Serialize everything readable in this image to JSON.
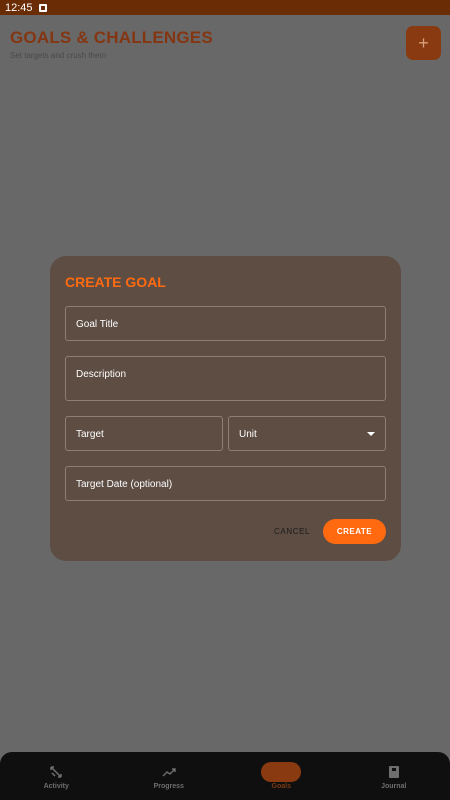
{
  "status_bar": {
    "time": "12:45",
    "notification_icon": "notification-icon"
  },
  "header": {
    "title": "GOALS & CHALLENGES",
    "subtitle": "Set targets and crush them",
    "add_label": "+"
  },
  "dialog": {
    "title": "CREATE GOAL",
    "fields": {
      "goal_title": "Goal Title",
      "description": "Description",
      "target": "Target",
      "unit": "Unit",
      "target_date": "Target Date (optional)"
    },
    "cancel_label": "CANCEL",
    "create_label": "CREATE"
  },
  "bottom_nav": {
    "items": [
      {
        "label": "Activity",
        "icon": "activity-icon"
      },
      {
        "label": "Progress",
        "icon": "trending-up-icon"
      },
      {
        "label": "Goals",
        "icon": "goals-icon",
        "active": true
      },
      {
        "label": "Journal",
        "icon": "journal-icon"
      }
    ]
  },
  "colors": {
    "accent": "#ff6a10",
    "status_bar": "#6a2c05",
    "dialog_bg": "#5d4d43",
    "scrim": "#686868",
    "nav_bg": "#0f0f0f"
  }
}
